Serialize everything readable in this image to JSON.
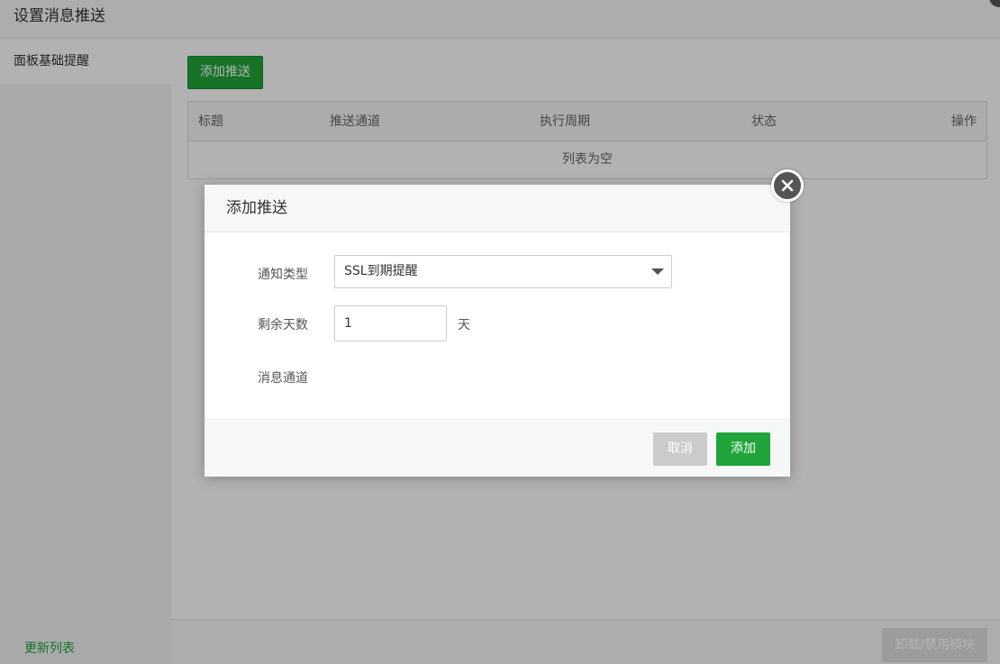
{
  "window": {
    "title": "设置消息推送"
  },
  "sidebar": {
    "items": [
      {
        "label": "面板基础提醒"
      }
    ],
    "footer_link": "更新列表"
  },
  "toolbar": {
    "add_push_label": "添加推送"
  },
  "table": {
    "columns": [
      "标题",
      "推送通道",
      "执行周期",
      "状态",
      "操作"
    ],
    "empty_text": "列表为空"
  },
  "bottom": {
    "uninstall_label": "卸载/禁用模块"
  },
  "modal": {
    "title": "添加推送",
    "close_icon": "close-icon",
    "fields": {
      "type_label": "通知类型",
      "type_value": "SSL到期提醒",
      "days_label": "剩余天数",
      "days_value": "1",
      "days_unit": "天",
      "channel_label": "消息通道"
    },
    "cancel_label": "取消",
    "confirm_label": "添加"
  },
  "colors": {
    "accent": "#20a53a",
    "overlay": "rgba(0,0,0,0.3)",
    "cancel": "#cbcbcb"
  }
}
